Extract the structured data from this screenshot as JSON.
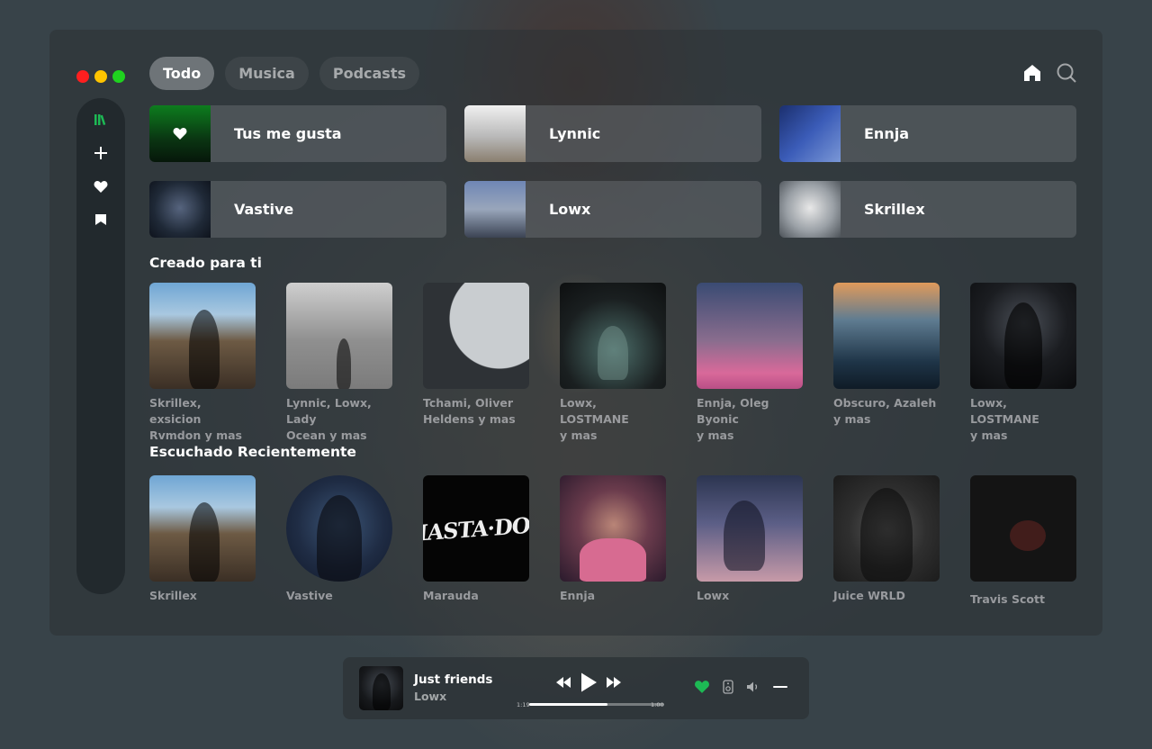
{
  "tabs": [
    {
      "label": "Todo",
      "active": true
    },
    {
      "label": "Musica",
      "active": false
    },
    {
      "label": "Podcasts",
      "active": false
    }
  ],
  "sidebar": {
    "icons": [
      "library-icon",
      "plus-icon",
      "heart-icon",
      "bookmark-icon"
    ]
  },
  "top_icons": [
    "home-icon",
    "search-icon"
  ],
  "quick_picks": [
    {
      "label": "Tus me gusta"
    },
    {
      "label": "Lynnic"
    },
    {
      "label": "Ennja"
    },
    {
      "label": "Vastive"
    },
    {
      "label": "Lowx"
    },
    {
      "label": "Skrillex"
    }
  ],
  "sections": {
    "made_for_you": {
      "title": "Creado para ti",
      "items": [
        {
          "line1": "Skrillex, exsicion",
          "line2": "Rvmdon y mas"
        },
        {
          "line1": "Lynnic, Lowx, Lady",
          "line2": "Ocean y mas"
        },
        {
          "line1": "Tchami, Oliver",
          "line2": "Heldens y mas"
        },
        {
          "line1": "Lowx, LOSTMANE",
          "line2": "y mas"
        },
        {
          "line1": "Ennja, Oleg Byonic",
          "line2": "y mas"
        },
        {
          "line1": "Obscuro, Azaleh",
          "line2": "y mas"
        },
        {
          "line1": "Lowx, LOSTMANE",
          "line2": "y mas"
        }
      ]
    },
    "recent": {
      "title": "Escuchado Recientemente",
      "items": [
        {
          "name": "Skrillex"
        },
        {
          "name": "Vastive"
        },
        {
          "name": "Marauda",
          "cover_text": "MASTA·DON"
        },
        {
          "name": "Ennja"
        },
        {
          "name": "Lowx"
        },
        {
          "name": "Juice WRLD"
        },
        {
          "name": "Travis Scott"
        }
      ]
    }
  },
  "player": {
    "title": "Just friends",
    "artist": "Lowx",
    "elapsed": "1:19",
    "duration": "1:00",
    "progress": 0.58,
    "liked": true
  },
  "colors": {
    "accent_green": "#1db954",
    "traffic_red": "#ff1f1f",
    "traffic_yellow": "#ffc400",
    "traffic_green": "#1fd21f"
  }
}
